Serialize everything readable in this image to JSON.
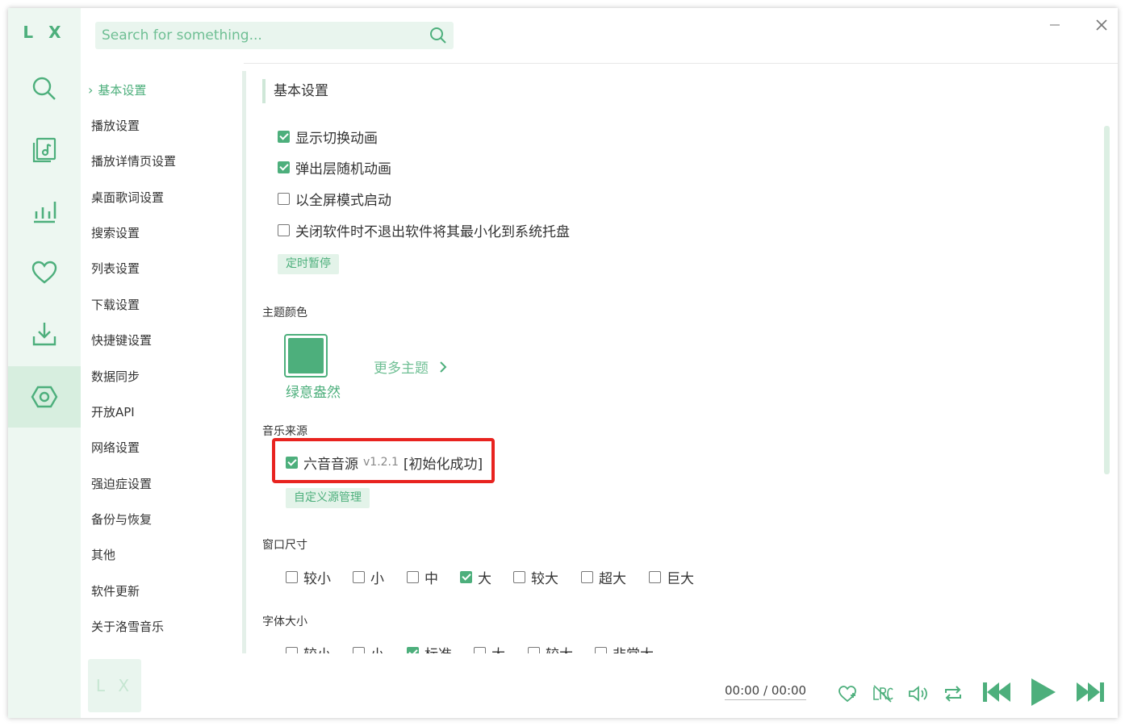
{
  "app": {
    "logo": "L X"
  },
  "colors": {
    "accent": "#4daf7c",
    "highlight_border": "#e8231f"
  },
  "search": {
    "placeholder": "Search for something..."
  },
  "nav_icons": [
    "search-icon",
    "music-list-icon",
    "chart-bars-icon",
    "heart-icon",
    "download-icon",
    "settings-icon"
  ],
  "window_controls": {
    "minimize": "−",
    "close": "×"
  },
  "sidebar": {
    "items": [
      {
        "label": "基本设置",
        "active": true
      },
      {
        "label": "播放设置"
      },
      {
        "label": "播放详情页设置"
      },
      {
        "label": "桌面歌词设置"
      },
      {
        "label": "搜索设置"
      },
      {
        "label": "列表设置"
      },
      {
        "label": "下载设置"
      },
      {
        "label": "快捷键设置"
      },
      {
        "label": "数据同步"
      },
      {
        "label": "开放API"
      },
      {
        "label": "网络设置"
      },
      {
        "label": "强迫症设置"
      },
      {
        "label": "备份与恢复"
      },
      {
        "label": "其他"
      },
      {
        "label": "软件更新"
      },
      {
        "label": "关于洛雪音乐"
      }
    ]
  },
  "basic": {
    "title": "基本设置",
    "options": [
      {
        "label": "显示切换动画",
        "checked": true
      },
      {
        "label": "弹出层随机动画",
        "checked": true
      },
      {
        "label": "以全屏模式启动",
        "checked": false
      },
      {
        "label": "关闭软件时不退出软件将其最小化到系统托盘",
        "checked": false
      }
    ],
    "timer_button": "定时暂停"
  },
  "theme": {
    "title": "主题颜色",
    "selected_name": "绿意盎然",
    "more_label": "更多主题"
  },
  "music_source": {
    "title": "音乐来源",
    "source_name": "六音音源",
    "version": "v1.2.1",
    "status": "[初始化成功]",
    "checked": true,
    "manage_button": "自定义源管理"
  },
  "window_size": {
    "title": "窗口尺寸",
    "options": [
      {
        "label": "较小",
        "checked": false
      },
      {
        "label": "小",
        "checked": false
      },
      {
        "label": "中",
        "checked": false
      },
      {
        "label": "大",
        "checked": true
      },
      {
        "label": "较大",
        "checked": false
      },
      {
        "label": "超大",
        "checked": false
      },
      {
        "label": "巨大",
        "checked": false
      }
    ]
  },
  "font_size": {
    "title": "字体大小",
    "options": [
      {
        "label": "较小",
        "checked": false
      },
      {
        "label": "小",
        "checked": false
      },
      {
        "label": "标准",
        "checked": true
      },
      {
        "label": "大",
        "checked": false
      },
      {
        "label": "较大",
        "checked": false
      },
      {
        "label": "非常大",
        "checked": false
      }
    ]
  },
  "player": {
    "logo": "L X",
    "current_time": "00:00",
    "separator": "/",
    "total_time": "00:00",
    "controls": [
      "heart-outline-icon",
      "lyric-icon",
      "volume-icon",
      "repeat-icon",
      "previous-icon",
      "play-icon",
      "next-icon"
    ]
  }
}
